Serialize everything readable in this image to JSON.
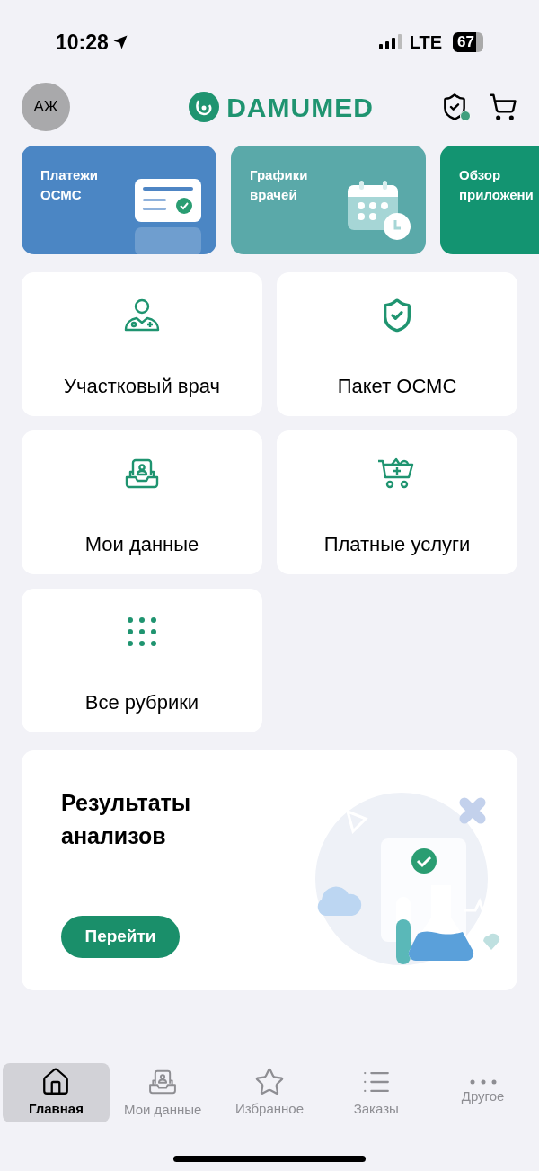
{
  "status_bar": {
    "time": "10:28",
    "network": "LTE",
    "battery": "67"
  },
  "header": {
    "avatar_initials": "АЖ",
    "logo": "DAMUMED"
  },
  "banners": [
    {
      "kind": "payments",
      "lines": [
        "Платежи",
        "ОСМС"
      ]
    },
    {
      "kind": "schedule",
      "lines": [
        "Графики",
        "врачей"
      ]
    },
    {
      "kind": "overview",
      "lines": [
        "Обзор",
        "приложени"
      ]
    }
  ],
  "tiles": [
    {
      "kind": "doctor",
      "label": "Участковый врач"
    },
    {
      "kind": "shield",
      "label": "Пакет ОСМС"
    },
    {
      "kind": "data",
      "label": "Мои данные"
    },
    {
      "kind": "cart",
      "label": "Платные услуги"
    },
    {
      "kind": "grid",
      "label": "Все рубрики"
    }
  ],
  "promo": {
    "title": "Результаты анализов",
    "button": "Перейти"
  },
  "tabs": [
    {
      "kind": "home",
      "label": "Главная",
      "selected": true
    },
    {
      "kind": "data",
      "label": "Мои данные",
      "selected": false
    },
    {
      "kind": "star",
      "label": "Избранное",
      "selected": false
    },
    {
      "kind": "list",
      "label": "Заказы",
      "selected": false
    },
    {
      "kind": "more",
      "label": "Другое",
      "selected": false
    }
  ]
}
